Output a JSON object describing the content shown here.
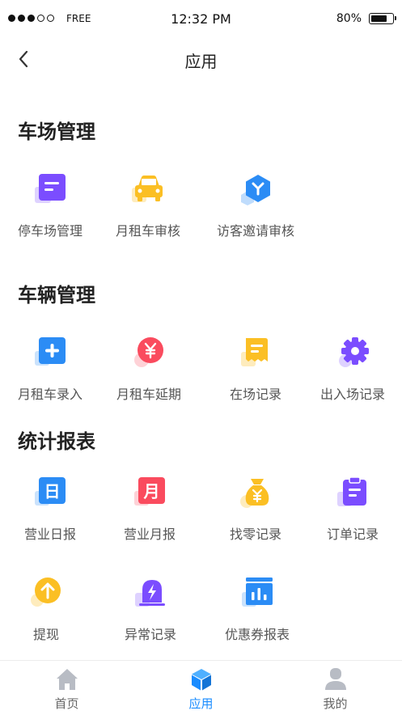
{
  "status_bar": {
    "carrier": "FREE",
    "time": "12:32 PM",
    "battery": "80%",
    "battery_level": 0.8
  },
  "nav": {
    "title": "应用"
  },
  "sections": [
    {
      "title": "车场管理",
      "items": [
        {
          "label": "停车场管理",
          "icon": "document-icon"
        },
        {
          "label": "月租车审核",
          "icon": "car-icon"
        },
        {
          "label": "访客邀请审核",
          "icon": "visitor-hexagon-icon"
        }
      ]
    },
    {
      "title": "车辆管理",
      "items": [
        {
          "label": "月租车录入",
          "icon": "plus-icon"
        },
        {
          "label": "月租车延期",
          "icon": "yen-icon"
        },
        {
          "label": "在场记录",
          "icon": "record-icon"
        },
        {
          "label": "出入场记录",
          "icon": "gear-icon"
        }
      ]
    },
    {
      "title": "统计报表",
      "items": [
        {
          "label": "营业日报",
          "icon": "daily-report-icon",
          "glyph": "日"
        },
        {
          "label": "营业月报",
          "icon": "monthly-report-icon",
          "glyph": "月"
        },
        {
          "label": "找零记录",
          "icon": "money-bag-icon"
        },
        {
          "label": "订单记录",
          "icon": "clipboard-icon"
        },
        {
          "label": "提现",
          "icon": "withdraw-arrow-icon"
        },
        {
          "label": "异常记录",
          "icon": "alarm-icon"
        },
        {
          "label": "优惠券报表",
          "icon": "coupon-chart-icon"
        }
      ]
    }
  ],
  "tabbar": {
    "items": [
      {
        "label": "首页",
        "icon": "home-icon",
        "active": false
      },
      {
        "label": "应用",
        "icon": "cube-icon",
        "active": true
      },
      {
        "label": "我的",
        "icon": "user-icon",
        "active": false
      }
    ]
  },
  "colors": {
    "blue": "#2b8cf5",
    "purple": "#7b4dff",
    "yellow": "#fbbf24",
    "red": "#fa4b5e",
    "active_tab": "#1a8cff",
    "inactive_tab": "#b8bcc4"
  }
}
